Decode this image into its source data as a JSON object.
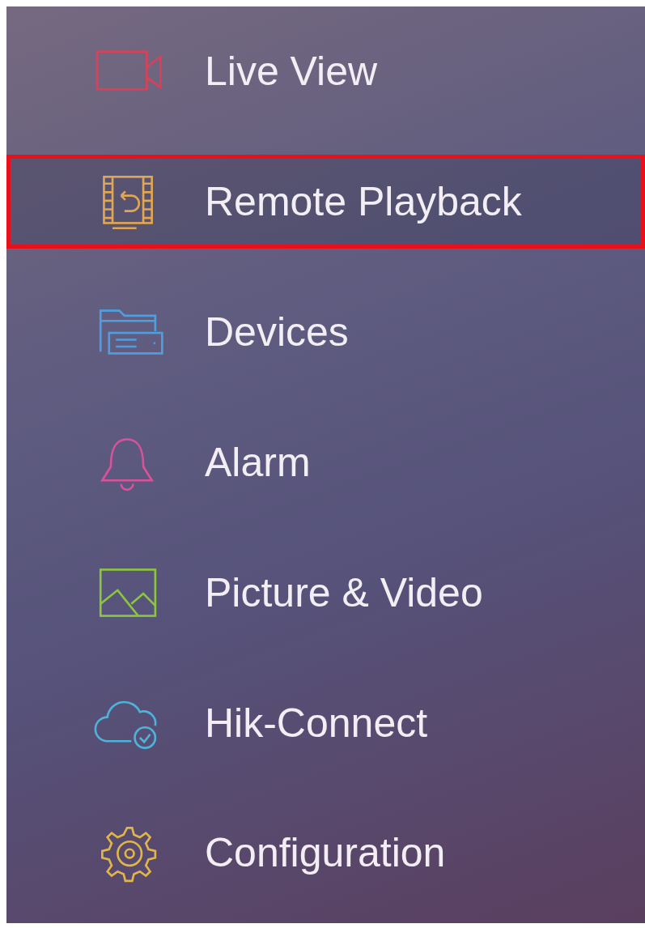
{
  "menu": {
    "items": [
      {
        "label": "Live View",
        "kind": "camera",
        "color": "#d9415a",
        "selected": false
      },
      {
        "label": "Remote Playback",
        "kind": "playback",
        "color": "#e0a654",
        "selected": true
      },
      {
        "label": "Devices",
        "kind": "devices",
        "color": "#4f9fe0",
        "selected": false
      },
      {
        "label": "Alarm",
        "kind": "bell",
        "color": "#d9529a",
        "selected": false
      },
      {
        "label": "Picture & Video",
        "kind": "picture",
        "color": "#8cc63f",
        "selected": false
      },
      {
        "label": "Hik-Connect",
        "kind": "cloud",
        "color": "#4fb3d9",
        "selected": false
      },
      {
        "label": "Configuration",
        "kind": "gear",
        "color": "#e0b64a",
        "selected": false
      }
    ]
  }
}
